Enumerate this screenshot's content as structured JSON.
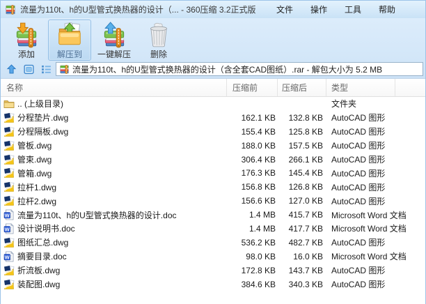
{
  "window": {
    "title": "流量为110t、h的U型管式换热器的设计（... - 360压缩 3.2正式版"
  },
  "menu": {
    "items": [
      {
        "id": "file",
        "label": "文件"
      },
      {
        "id": "actions",
        "label": "操作"
      },
      {
        "id": "tools",
        "label": "工具"
      },
      {
        "id": "help",
        "label": "帮助"
      }
    ]
  },
  "toolbar": {
    "buttons": [
      {
        "id": "add",
        "label": "添加",
        "icon": "add-archive-icon",
        "selected": false
      },
      {
        "id": "extract-to",
        "label": "解压到",
        "icon": "extract-to-icon",
        "selected": true
      },
      {
        "id": "one-click-extract",
        "label": "一键解压",
        "icon": "one-click-extract-icon",
        "selected": false
      },
      {
        "id": "delete",
        "label": "删除",
        "icon": "delete-icon",
        "selected": false
      }
    ]
  },
  "addressbar": {
    "archive_info": "流量为110t、h的U型管式换热器的设计（含全套CAD图纸）.rar - 解包大小为 5.2 MB"
  },
  "table": {
    "columns": [
      {
        "label": "名称"
      },
      {
        "label": "压缩前"
      },
      {
        "label": "压缩后"
      },
      {
        "label": "类型"
      }
    ],
    "rows": [
      {
        "name": ".. (上级目录)",
        "before": "",
        "after": "",
        "type": "文件夹",
        "icon": "folder-icon"
      },
      {
        "name": "分程垫片.dwg",
        "before": "162.1 KB",
        "after": "132.8 KB",
        "type": "AutoCAD 图形",
        "icon": "dwg-file-icon"
      },
      {
        "name": "分程隔板.dwg",
        "before": "155.4 KB",
        "after": "125.8 KB",
        "type": "AutoCAD 图形",
        "icon": "dwg-file-icon"
      },
      {
        "name": "管板.dwg",
        "before": "188.0 KB",
        "after": "157.5 KB",
        "type": "AutoCAD 图形",
        "icon": "dwg-file-icon"
      },
      {
        "name": "管束.dwg",
        "before": "306.4 KB",
        "after": "266.1 KB",
        "type": "AutoCAD 图形",
        "icon": "dwg-file-icon"
      },
      {
        "name": "管箱.dwg",
        "before": "176.3 KB",
        "after": "145.4 KB",
        "type": "AutoCAD 图形",
        "icon": "dwg-file-icon"
      },
      {
        "name": "拉杆1.dwg",
        "before": "156.8 KB",
        "after": "126.8 KB",
        "type": "AutoCAD 图形",
        "icon": "dwg-file-icon"
      },
      {
        "name": "拉杆2.dwg",
        "before": "156.6 KB",
        "after": "127.0 KB",
        "type": "AutoCAD 图形",
        "icon": "dwg-file-icon"
      },
      {
        "name": "流量为110t、h的U型管式换热器的设计.doc",
        "before": "1.4 MB",
        "after": "415.7 KB",
        "type": "Microsoft Word 文档",
        "icon": "word-doc-icon"
      },
      {
        "name": "设计说明书.doc",
        "before": "1.4 MB",
        "after": "417.7 KB",
        "type": "Microsoft Word 文档",
        "icon": "word-doc-icon"
      },
      {
        "name": "图纸汇总.dwg",
        "before": "536.2 KB",
        "after": "482.7 KB",
        "type": "AutoCAD 图形",
        "icon": "dwg-file-icon"
      },
      {
        "name": "摘要目录.doc",
        "before": "98.0 KB",
        "after": "16.0 KB",
        "type": "Microsoft Word 文档",
        "icon": "word-doc-icon"
      },
      {
        "name": "折流板.dwg",
        "before": "172.8 KB",
        "after": "143.7 KB",
        "type": "AutoCAD 图形",
        "icon": "dwg-file-icon"
      },
      {
        "name": "装配图.dwg",
        "before": "384.6 KB",
        "after": "340.3 KB",
        "type": "AutoCAD 图形",
        "icon": "dwg-file-icon"
      }
    ]
  },
  "colors": {
    "titlebar_top": "#e3f2fd",
    "titlebar_bottom": "#c9e2f6",
    "toolbar_bg": "#d6e9fa",
    "selected_button_border": "#94bfe6",
    "accent_blue": "#4a90d0",
    "zipper_orange": "#e59022",
    "header_text": "#666666",
    "row_text": "#1a1a1a"
  }
}
